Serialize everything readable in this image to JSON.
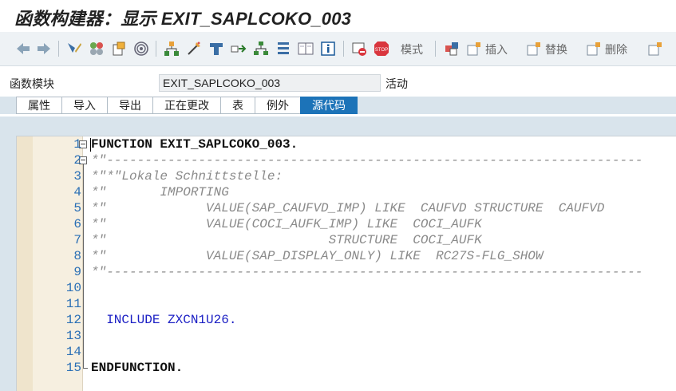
{
  "window": {
    "title": "函数构建器：显示 EXIT_SAPLCOKO_003"
  },
  "toolbar": {
    "mode_label": "模式",
    "insert_label": "插入",
    "replace_label": "替换",
    "delete_label": "删除"
  },
  "field": {
    "label": "函数模块",
    "value": "EXIT_SAPLCOKO_003",
    "status": "活动"
  },
  "tabs": [
    "属性",
    "导入",
    "导出",
    "正在更改",
    "表",
    "例外",
    "源代码"
  ],
  "active_tab": "源代码",
  "editor": {
    "lines": [
      {
        "num": "1",
        "text": "FUNCTION EXIT_SAPLCOKO_003."
      },
      {
        "num": "2",
        "text": "*\"----------------------------------------------------------------------"
      },
      {
        "num": "3",
        "text": "*\"*\"Lokale Schnittstelle:"
      },
      {
        "num": "4",
        "text": "*\"       IMPORTING"
      },
      {
        "num": "5",
        "text": "*\"             VALUE(SAP_CAUFVD_IMP) LIKE  CAUFVD STRUCTURE  CAUFVD"
      },
      {
        "num": "6",
        "text": "*\"             VALUE(COCI_AUFK_IMP) LIKE  COCI_AUFK"
      },
      {
        "num": "7",
        "text": "*\"                             STRUCTURE  COCI_AUFK"
      },
      {
        "num": "8",
        "text": "*\"             VALUE(SAP_DISPLAY_ONLY) LIKE  RC27S-FLG_SHOW"
      },
      {
        "num": "9",
        "text": "*\"----------------------------------------------------------------------"
      },
      {
        "num": "10",
        "text": ""
      },
      {
        "num": "11",
        "text": ""
      },
      {
        "num": "12",
        "text": "  INCLUDE ZXCN1U26."
      },
      {
        "num": "13",
        "text": ""
      },
      {
        "num": "14",
        "text": ""
      },
      {
        "num": "15",
        "text": "ENDFUNCTION."
      }
    ]
  },
  "colors": {
    "active_tab_bg": "#1c73b8",
    "line_number": "#2a6fb5",
    "comment": "#8a8a8a",
    "keyword": "#1b1fc4",
    "gutter_bg": "#f6efe0"
  }
}
